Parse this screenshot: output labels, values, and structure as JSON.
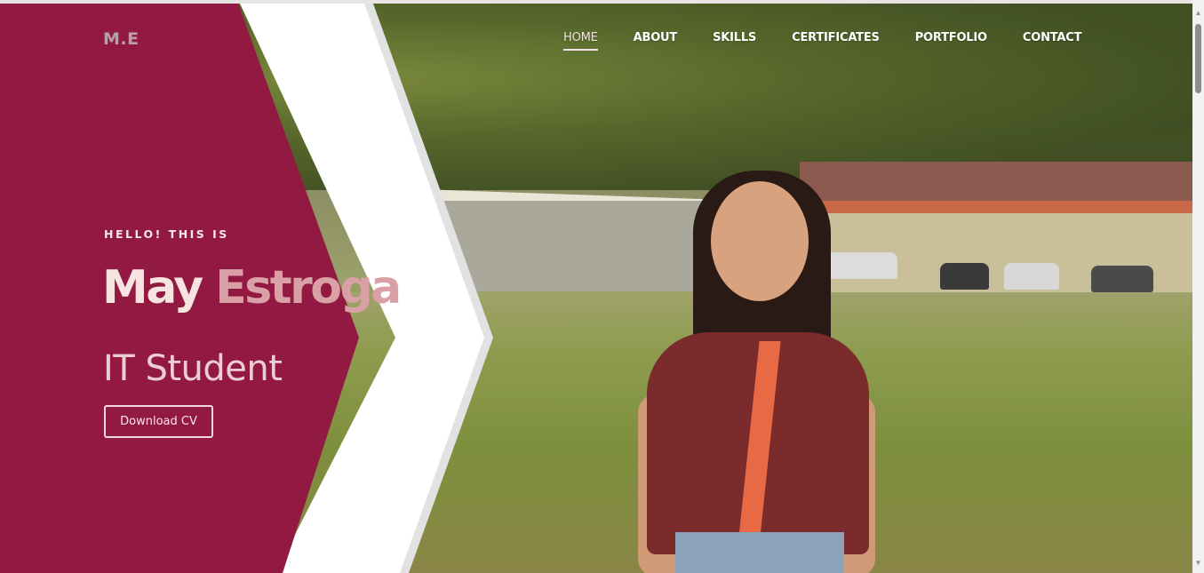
{
  "header": {
    "logo": "M.E",
    "nav": [
      {
        "label": "HOME",
        "active": true
      },
      {
        "label": "ABOUT",
        "active": false
      },
      {
        "label": "SKILLS",
        "active": false
      },
      {
        "label": "CERTIFICATES",
        "active": false
      },
      {
        "label": "PORTFOLIO",
        "active": false
      },
      {
        "label": "CONTACT",
        "active": false
      }
    ]
  },
  "hero": {
    "greeting": "HELLO! THIS IS",
    "first_name": "May",
    "last_name": "Estroga",
    "role": "IT Student",
    "cta_label": "Download CV"
  },
  "colors": {
    "panel": "#921a42",
    "chevron": "#ffffff",
    "chevron_shadow": "#e2e2e2",
    "name_first": "#f6e4e1",
    "name_last": "#d9a1a6"
  },
  "icons": {
    "scroll_up": "triangle-up",
    "scroll_down": "triangle-down"
  }
}
